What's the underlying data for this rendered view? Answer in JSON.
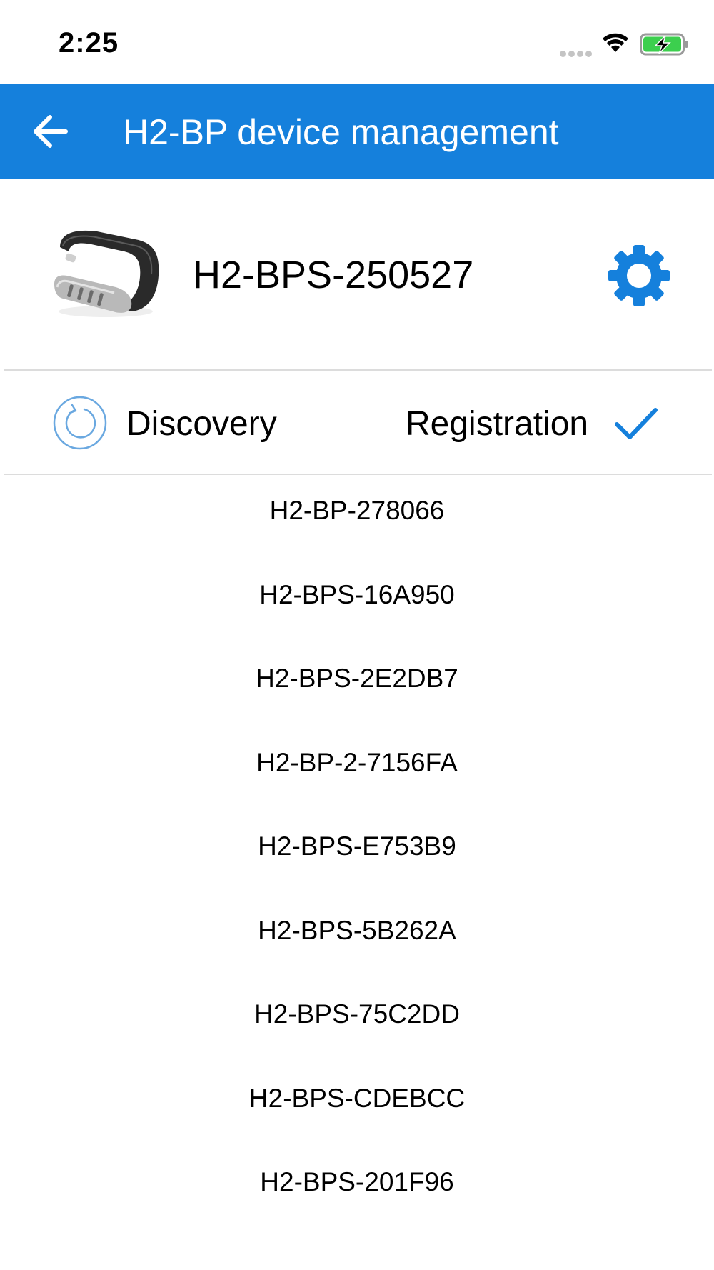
{
  "status_bar": {
    "time": "2:25"
  },
  "app_bar": {
    "title": "H2-BP device management",
    "color": "#1580dc"
  },
  "device": {
    "name": "H2-BPS-250527"
  },
  "actions": {
    "discovery_label": "Discovery",
    "registration_label": "Registration"
  },
  "icons": {
    "back": "arrow-left-icon",
    "settings": "gear-icon",
    "refresh": "refresh-icon",
    "check": "checkmark-icon",
    "wifi": "wifi-icon",
    "battery": "battery-charging-icon"
  },
  "colors": {
    "accent": "#1580dc",
    "battery_fill": "#3ccf4e",
    "refresh_ring": "#6aa8e0"
  },
  "device_list": [
    "H2-BP-278066",
    "H2-BPS-16A950",
    "H2-BPS-2E2DB7",
    "H2-BP-2-7156FA",
    "H2-BPS-E753B9",
    "H2-BPS-5B262A",
    "H2-BPS-75C2DD",
    "H2-BPS-CDEBCC",
    "H2-BPS-201F96"
  ]
}
